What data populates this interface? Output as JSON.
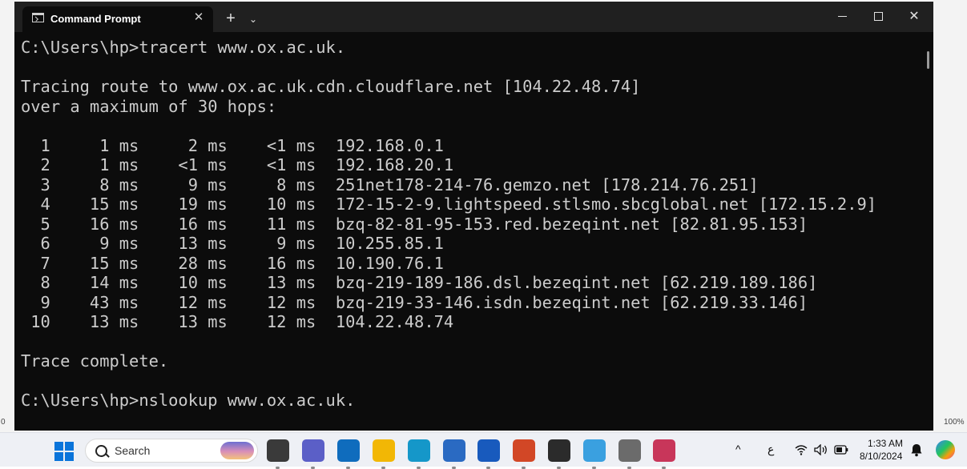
{
  "window": {
    "tab_title": "Command Prompt",
    "close_tab_glyph": "✕",
    "new_tab_glyph": "+",
    "dropdown_glyph": "⌄",
    "close_glyph": "✕"
  },
  "console_lines": [
    "C:\\Users\\hp>tracert www.ox.ac.uk.",
    "",
    "Tracing route to www.ox.ac.uk.cdn.cloudflare.net [104.22.48.74]",
    "over a maximum of 30 hops:",
    "",
    "  1     1 ms     2 ms    <1 ms  192.168.0.1",
    "  2     1 ms    <1 ms    <1 ms  192.168.20.1",
    "  3     8 ms     9 ms     8 ms  251net178-214-76.gemzo.net [178.214.76.251]",
    "  4    15 ms    19 ms    10 ms  172-15-2-9.lightspeed.stlsmo.sbcglobal.net [172.15.2.9]",
    "  5    16 ms    16 ms    11 ms  bzq-82-81-95-153.red.bezeqint.net [82.81.95.153]",
    "  6     9 ms    13 ms     9 ms  10.255.85.1",
    "  7    15 ms    28 ms    16 ms  10.190.76.1",
    "  8    14 ms    10 ms    13 ms  bzq-219-189-186.dsl.bezeqint.net [62.219.189.186]",
    "  9    43 ms    12 ms    12 ms  bzq-219-33-146.isdn.bezeqint.net [62.219.33.146]",
    " 10    13 ms    13 ms    12 ms  104.22.48.74",
    "",
    "Trace complete.",
    "",
    "C:\\Users\\hp>nslookup www.ox.ac.uk."
  ],
  "edges": {
    "left": "0",
    "right": "100%"
  },
  "taskbar": {
    "search_label": "Search",
    "language": "ع",
    "time": "1:33 AM",
    "date": "8/10/2024",
    "apps": [
      {
        "name": "task-view",
        "color": "#3a3a3a"
      },
      {
        "name": "teams",
        "color": "#5b5fc7"
      },
      {
        "name": "mail",
        "color": "#0f6cbd"
      },
      {
        "name": "file-explorer",
        "color": "#f2b705"
      },
      {
        "name": "edge",
        "color": "#1597c9"
      },
      {
        "name": "microsoft-store",
        "color": "#2a6ac2"
      },
      {
        "name": "word",
        "color": "#185abd"
      },
      {
        "name": "powerpoint",
        "color": "#d24726"
      },
      {
        "name": "terminal",
        "color": "#2b2b2b"
      },
      {
        "name": "control-panel",
        "color": "#3aa0e0"
      },
      {
        "name": "settings",
        "color": "#6b6b6b"
      },
      {
        "name": "snipping-tool",
        "color": "#c8365a"
      }
    ]
  }
}
